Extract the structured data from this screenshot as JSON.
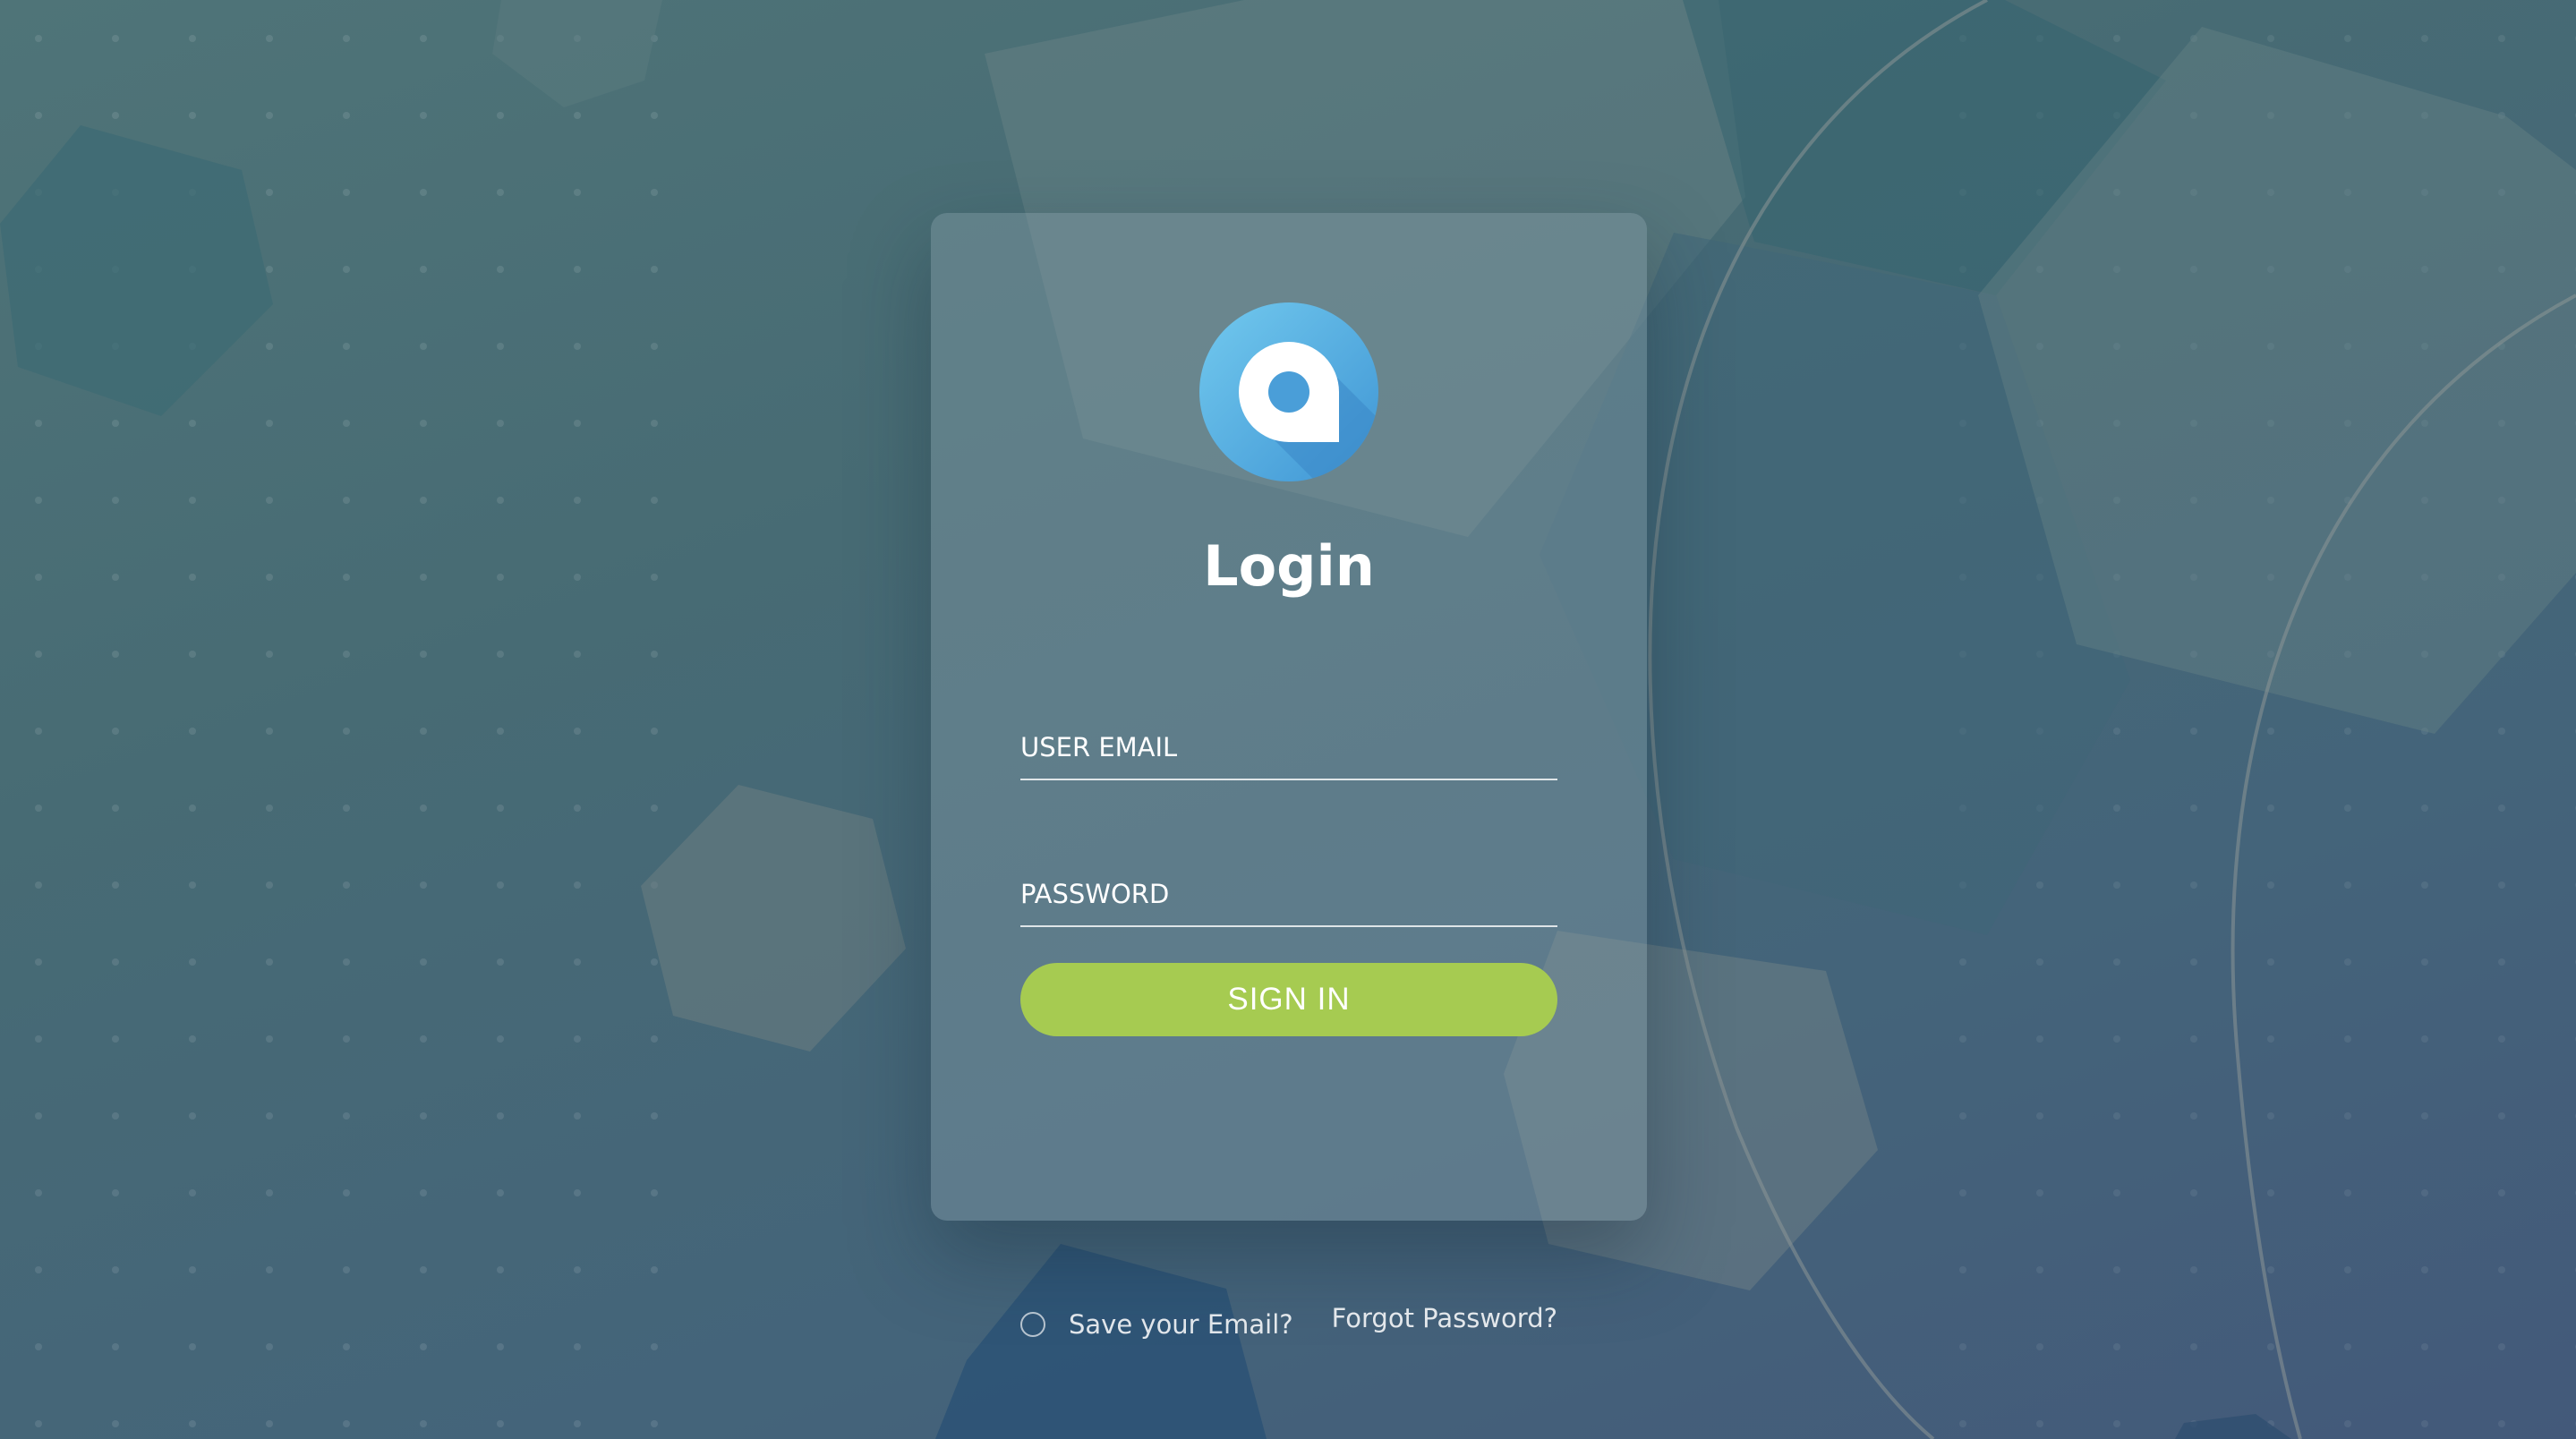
{
  "login": {
    "title": "Login",
    "email_placeholder": "USER EMAIL",
    "password_placeholder": "PASSWORD",
    "signin_label": "SIGN IN",
    "save_email_label": "Save your Email?",
    "forgot_password_label": "Forgot Password?"
  },
  "colors": {
    "accent_button": "#a6cb51",
    "logo_light": "#6dc3ec",
    "logo_dark": "#3a8fd0"
  },
  "icons": {
    "logo": "logo-icon",
    "save_email_toggle": "radio-icon"
  }
}
